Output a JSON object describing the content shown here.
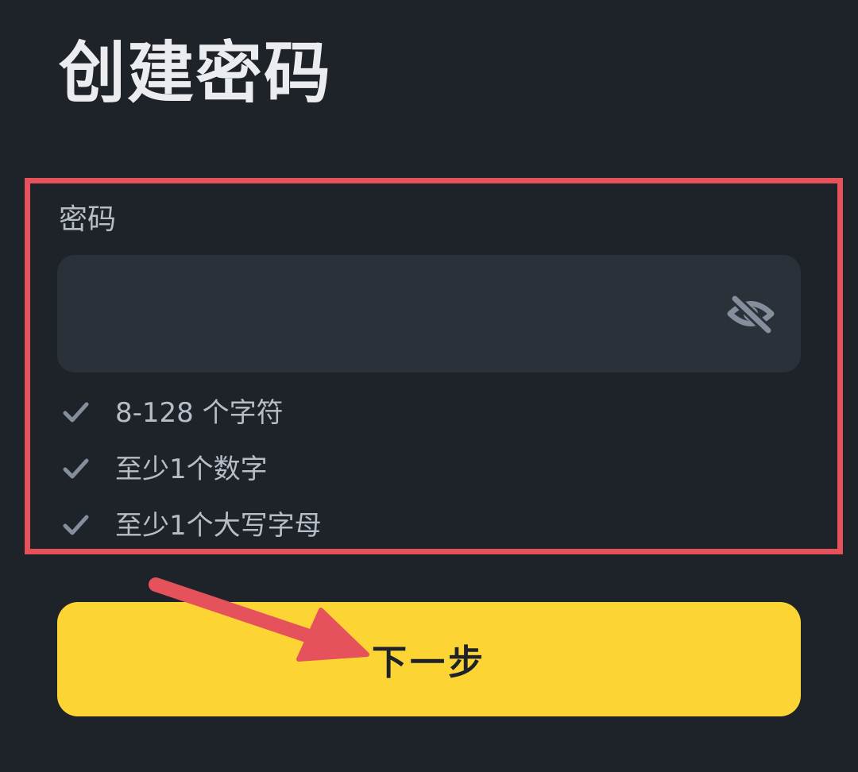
{
  "page": {
    "title": "创建密码"
  },
  "password": {
    "label": "密码",
    "value": "",
    "visibility_icon": "eye-off-icon"
  },
  "requirements": [
    {
      "text": "8-128 个字符",
      "icon": "check-icon"
    },
    {
      "text": "至少1个数字",
      "icon": "check-icon"
    },
    {
      "text": "至少1个大写字母",
      "icon": "check-icon"
    }
  ],
  "actions": {
    "next_label": "下一步"
  },
  "colors": {
    "background": "#1e2329",
    "input_background": "#2b3139",
    "accent": "#fcd535",
    "annotation": "#e5525c",
    "muted_text": "#b7bdc6"
  }
}
